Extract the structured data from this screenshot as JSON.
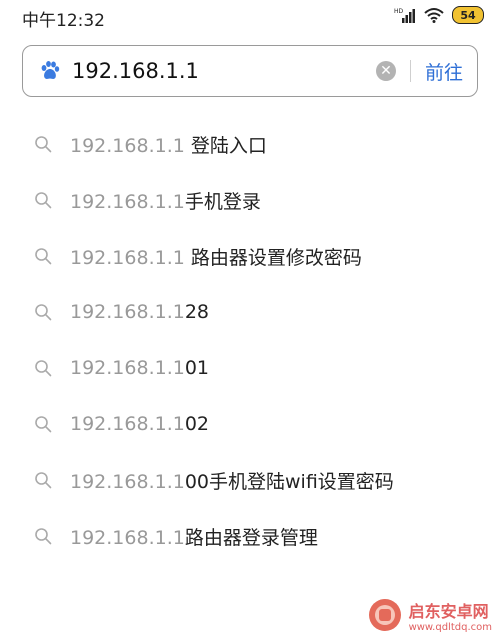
{
  "status_bar": {
    "time": "中午12:32",
    "battery": "54"
  },
  "search": {
    "value": "192.168.1.1",
    "go_label": "前往"
  },
  "suggestions": [
    {
      "prefix": "192.168.1.1",
      "suffix": " 登陆入口"
    },
    {
      "prefix": "192.168.1.1",
      "suffix": "手机登录"
    },
    {
      "prefix": "192.168.1.1",
      "suffix": " 路由器设置修改密码"
    },
    {
      "prefix": "192.168.1.1",
      "suffix": "28"
    },
    {
      "prefix": "192.168.1.1",
      "suffix": "01"
    },
    {
      "prefix": "192.168.1.1",
      "suffix": "02"
    },
    {
      "prefix": "192.168.1.1",
      "suffix": "00手机登陆wifi设置密码"
    },
    {
      "prefix": "192.168.1.1",
      "suffix": "路由器登录管理"
    }
  ],
  "watermark": {
    "name": "启东安卓网",
    "url": "www.qdltdq.com"
  },
  "colors": {
    "accent": "#2f6fd6",
    "paw": "#3b7be0",
    "muted": "#999999",
    "battery": "#f1c232"
  }
}
